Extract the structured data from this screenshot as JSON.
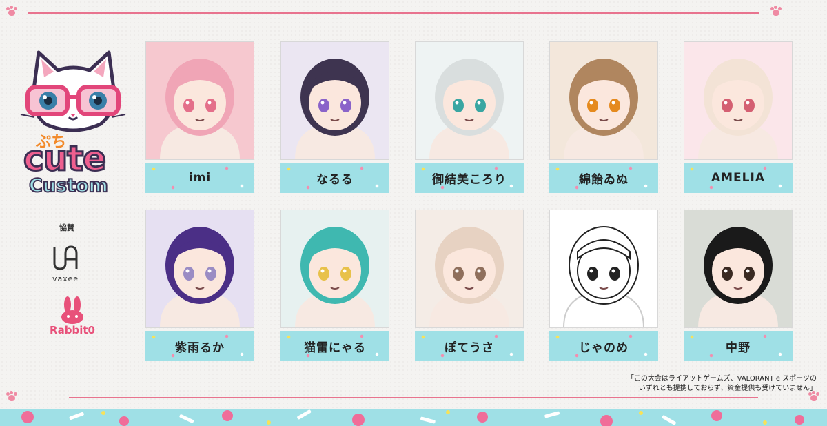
{
  "brand": {
    "logo_small": "ぷち",
    "logo_main": "cute",
    "logo_sub": "Custom"
  },
  "sponsors": {
    "label": "協賛",
    "items": [
      {
        "name": "vaxee"
      },
      {
        "name": "Rabbit0"
      }
    ]
  },
  "players": [
    {
      "name": "imi",
      "bg": "#f6c8cf",
      "hair": "#f0a5b6",
      "eye": "#e46f8a"
    },
    {
      "name": "なるる",
      "bg": "#ebe6f2",
      "hair": "#3e3450",
      "eye": "#8a63c9"
    },
    {
      "name": "御結美ころり",
      "bg": "#eef3f3",
      "hair": "#d9dede",
      "eye": "#39a6a2"
    },
    {
      "name": "綿飴ゐぬ",
      "bg": "#f3e7db",
      "hair": "#b0865f",
      "eye": "#e58a1e"
    },
    {
      "name": "AMELIA",
      "bg": "#fbe6ea",
      "hair": "#f3e3d6",
      "eye": "#d45f72"
    },
    {
      "name": "紫雨るか",
      "bg": "#e6e0f2",
      "hair": "#4b2f86",
      "eye": "#9a8cc4"
    },
    {
      "name": "猫雷にゃる",
      "bg": "#e7f1f0",
      "hair": "#3fb8b0",
      "eye": "#e8c14a"
    },
    {
      "name": "ぽてうさ",
      "bg": "#f4ece6",
      "hair": "#e7d2c2",
      "eye": "#8f6f5c"
    },
    {
      "name": "じゃのめ",
      "bg": "#ffffff",
      "hair": "#ffffff",
      "eye": "#222222"
    },
    {
      "name": "中野",
      "bg": "#d9dcd6",
      "hair": "#1a1a1a",
      "eye": "#3a2a22"
    }
  ],
  "disclaimer": {
    "line1": "「この大会はライアットゲームズ、VALORANT e スポーツの",
    "line2": "いずれとも提携しておらず、資金提供も受けていません」"
  }
}
